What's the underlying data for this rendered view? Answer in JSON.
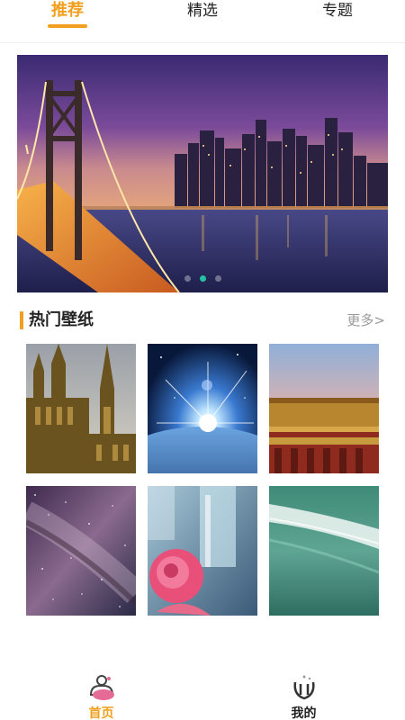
{
  "top_tabs": [
    {
      "label": "推荐",
      "active": true
    },
    {
      "label": "精选",
      "active": false
    },
    {
      "label": "专题",
      "active": false
    }
  ],
  "banner": {
    "image": "city bridge at dusk",
    "dot_count": 3,
    "active_dot": 1
  },
  "section": {
    "title": "热门壁纸",
    "more": "更多>"
  },
  "wallpapers": [
    {
      "image": "gothic cathedral"
    },
    {
      "image": "sunrise over earth from space"
    },
    {
      "image": "chinese palace roof"
    },
    {
      "image": "milky way starfield"
    },
    {
      "image": "pink rose with crystal"
    },
    {
      "image": "green ocean wave"
    }
  ],
  "bottom_nav": [
    {
      "label": "首页",
      "icon": "home-icon",
      "active": true
    },
    {
      "label": "我的",
      "icon": "profile-icon",
      "active": false
    }
  ],
  "colors": {
    "accent": "#f0a01e",
    "dot_active": "#24c3a4",
    "more_text": "#9a9a9a"
  }
}
